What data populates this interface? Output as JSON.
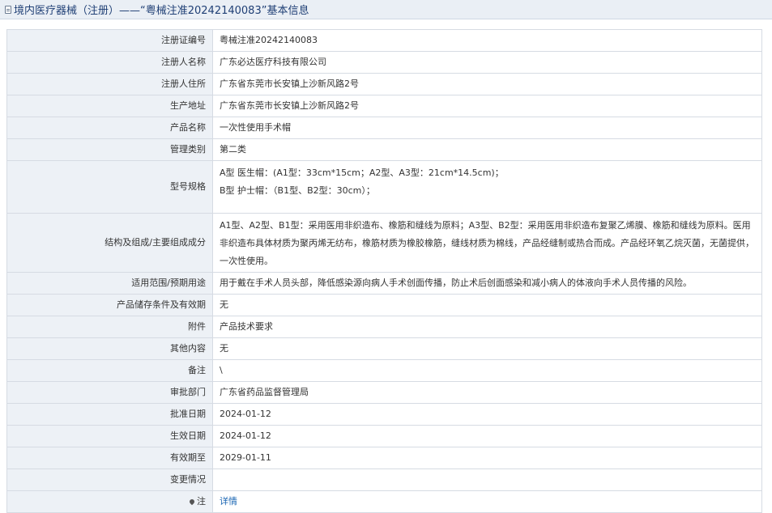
{
  "page": {
    "title": "境内医疗器械（注册）——“粤械注准20242140083”基本信息",
    "icon": "document-icon"
  },
  "rows": [
    {
      "label": "注册证编号",
      "value": "粤械注准20242140083"
    },
    {
      "label": "注册人名称",
      "value": "广东必达医疗科技有限公司"
    },
    {
      "label": "注册人住所",
      "value": "广东省东莞市长安镇上沙新风路2号"
    },
    {
      "label": "生产地址",
      "value": "广东省东莞市长安镇上沙新风路2号"
    },
    {
      "label": "产品名称",
      "value": "一次性使用手术帽"
    },
    {
      "label": "管理类别",
      "value": "第二类"
    },
    {
      "label": "型号规格",
      "value": "A型 医生帽：(A1型：33cm*15cm；A2型、A3型：21cm*14.5cm)；\nB型 护士帽：（B1型、B2型：30cm）；"
    },
    {
      "label": "结构及组成/主要组成成分",
      "value": "A1型、A2型、B1型：采用医用非织造布、橡筋和缝线为原料；A3型、B2型：采用医用非织造布复聚乙烯膜、橡筋和缝线为原料。医用非织造布具体材质为聚丙烯无纺布，橡筋材质为橡胶橡筋，缝线材质为棉线，产品经缝制或热合而成。产品经环氧乙烷灭菌，无菌提供，一次性使用。"
    },
    {
      "label": "适用范围/预期用途",
      "value": "用于戴在手术人员头部，降低感染源向病人手术创面传播，防止术后创面感染和减小病人的体液向手术人员传播的风险。"
    },
    {
      "label": "产品储存条件及有效期",
      "value": "无"
    },
    {
      "label": "附件",
      "value": "产品技术要求"
    },
    {
      "label": "其他内容",
      "value": "无"
    },
    {
      "label": "备注",
      "value": "\\"
    },
    {
      "label": "审批部门",
      "value": "广东省药品监督管理局"
    },
    {
      "label": "批准日期",
      "value": "2024-01-12"
    },
    {
      "label": "生效日期",
      "value": "2024-01-12"
    },
    {
      "label": "有效期至",
      "value": "2029-01-11"
    },
    {
      "label": "变更情况",
      "value": ""
    }
  ],
  "note": {
    "label": "注",
    "icon": "pin-icon",
    "link": "详情"
  }
}
